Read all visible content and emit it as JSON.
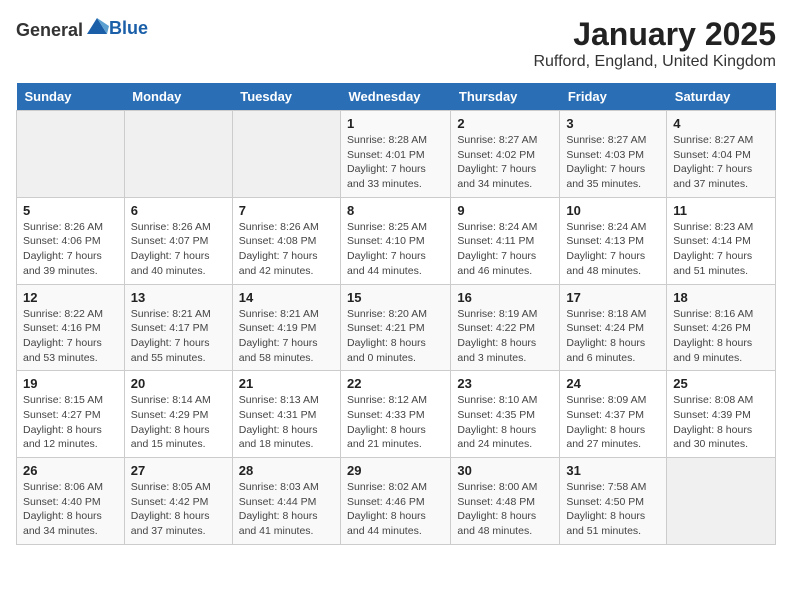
{
  "header": {
    "logo_general": "General",
    "logo_blue": "Blue",
    "title": "January 2025",
    "location": "Rufford, England, United Kingdom"
  },
  "days_of_week": [
    "Sunday",
    "Monday",
    "Tuesday",
    "Wednesday",
    "Thursday",
    "Friday",
    "Saturday"
  ],
  "weeks": [
    [
      {
        "day": "",
        "sunrise": "",
        "sunset": "",
        "daylight": ""
      },
      {
        "day": "",
        "sunrise": "",
        "sunset": "",
        "daylight": ""
      },
      {
        "day": "",
        "sunrise": "",
        "sunset": "",
        "daylight": ""
      },
      {
        "day": "1",
        "sunrise": "Sunrise: 8:28 AM",
        "sunset": "Sunset: 4:01 PM",
        "daylight": "Daylight: 7 hours and 33 minutes."
      },
      {
        "day": "2",
        "sunrise": "Sunrise: 8:27 AM",
        "sunset": "Sunset: 4:02 PM",
        "daylight": "Daylight: 7 hours and 34 minutes."
      },
      {
        "day": "3",
        "sunrise": "Sunrise: 8:27 AM",
        "sunset": "Sunset: 4:03 PM",
        "daylight": "Daylight: 7 hours and 35 minutes."
      },
      {
        "day": "4",
        "sunrise": "Sunrise: 8:27 AM",
        "sunset": "Sunset: 4:04 PM",
        "daylight": "Daylight: 7 hours and 37 minutes."
      }
    ],
    [
      {
        "day": "5",
        "sunrise": "Sunrise: 8:26 AM",
        "sunset": "Sunset: 4:06 PM",
        "daylight": "Daylight: 7 hours and 39 minutes."
      },
      {
        "day": "6",
        "sunrise": "Sunrise: 8:26 AM",
        "sunset": "Sunset: 4:07 PM",
        "daylight": "Daylight: 7 hours and 40 minutes."
      },
      {
        "day": "7",
        "sunrise": "Sunrise: 8:26 AM",
        "sunset": "Sunset: 4:08 PM",
        "daylight": "Daylight: 7 hours and 42 minutes."
      },
      {
        "day": "8",
        "sunrise": "Sunrise: 8:25 AM",
        "sunset": "Sunset: 4:10 PM",
        "daylight": "Daylight: 7 hours and 44 minutes."
      },
      {
        "day": "9",
        "sunrise": "Sunrise: 8:24 AM",
        "sunset": "Sunset: 4:11 PM",
        "daylight": "Daylight: 7 hours and 46 minutes."
      },
      {
        "day": "10",
        "sunrise": "Sunrise: 8:24 AM",
        "sunset": "Sunset: 4:13 PM",
        "daylight": "Daylight: 7 hours and 48 minutes."
      },
      {
        "day": "11",
        "sunrise": "Sunrise: 8:23 AM",
        "sunset": "Sunset: 4:14 PM",
        "daylight": "Daylight: 7 hours and 51 minutes."
      }
    ],
    [
      {
        "day": "12",
        "sunrise": "Sunrise: 8:22 AM",
        "sunset": "Sunset: 4:16 PM",
        "daylight": "Daylight: 7 hours and 53 minutes."
      },
      {
        "day": "13",
        "sunrise": "Sunrise: 8:21 AM",
        "sunset": "Sunset: 4:17 PM",
        "daylight": "Daylight: 7 hours and 55 minutes."
      },
      {
        "day": "14",
        "sunrise": "Sunrise: 8:21 AM",
        "sunset": "Sunset: 4:19 PM",
        "daylight": "Daylight: 7 hours and 58 minutes."
      },
      {
        "day": "15",
        "sunrise": "Sunrise: 8:20 AM",
        "sunset": "Sunset: 4:21 PM",
        "daylight": "Daylight: 8 hours and 0 minutes."
      },
      {
        "day": "16",
        "sunrise": "Sunrise: 8:19 AM",
        "sunset": "Sunset: 4:22 PM",
        "daylight": "Daylight: 8 hours and 3 minutes."
      },
      {
        "day": "17",
        "sunrise": "Sunrise: 8:18 AM",
        "sunset": "Sunset: 4:24 PM",
        "daylight": "Daylight: 8 hours and 6 minutes."
      },
      {
        "day": "18",
        "sunrise": "Sunrise: 8:16 AM",
        "sunset": "Sunset: 4:26 PM",
        "daylight": "Daylight: 8 hours and 9 minutes."
      }
    ],
    [
      {
        "day": "19",
        "sunrise": "Sunrise: 8:15 AM",
        "sunset": "Sunset: 4:27 PM",
        "daylight": "Daylight: 8 hours and 12 minutes."
      },
      {
        "day": "20",
        "sunrise": "Sunrise: 8:14 AM",
        "sunset": "Sunset: 4:29 PM",
        "daylight": "Daylight: 8 hours and 15 minutes."
      },
      {
        "day": "21",
        "sunrise": "Sunrise: 8:13 AM",
        "sunset": "Sunset: 4:31 PM",
        "daylight": "Daylight: 8 hours and 18 minutes."
      },
      {
        "day": "22",
        "sunrise": "Sunrise: 8:12 AM",
        "sunset": "Sunset: 4:33 PM",
        "daylight": "Daylight: 8 hours and 21 minutes."
      },
      {
        "day": "23",
        "sunrise": "Sunrise: 8:10 AM",
        "sunset": "Sunset: 4:35 PM",
        "daylight": "Daylight: 8 hours and 24 minutes."
      },
      {
        "day": "24",
        "sunrise": "Sunrise: 8:09 AM",
        "sunset": "Sunset: 4:37 PM",
        "daylight": "Daylight: 8 hours and 27 minutes."
      },
      {
        "day": "25",
        "sunrise": "Sunrise: 8:08 AM",
        "sunset": "Sunset: 4:39 PM",
        "daylight": "Daylight: 8 hours and 30 minutes."
      }
    ],
    [
      {
        "day": "26",
        "sunrise": "Sunrise: 8:06 AM",
        "sunset": "Sunset: 4:40 PM",
        "daylight": "Daylight: 8 hours and 34 minutes."
      },
      {
        "day": "27",
        "sunrise": "Sunrise: 8:05 AM",
        "sunset": "Sunset: 4:42 PM",
        "daylight": "Daylight: 8 hours and 37 minutes."
      },
      {
        "day": "28",
        "sunrise": "Sunrise: 8:03 AM",
        "sunset": "Sunset: 4:44 PM",
        "daylight": "Daylight: 8 hours and 41 minutes."
      },
      {
        "day": "29",
        "sunrise": "Sunrise: 8:02 AM",
        "sunset": "Sunset: 4:46 PM",
        "daylight": "Daylight: 8 hours and 44 minutes."
      },
      {
        "day": "30",
        "sunrise": "Sunrise: 8:00 AM",
        "sunset": "Sunset: 4:48 PM",
        "daylight": "Daylight: 8 hours and 48 minutes."
      },
      {
        "day": "31",
        "sunrise": "Sunrise: 7:58 AM",
        "sunset": "Sunset: 4:50 PM",
        "daylight": "Daylight: 8 hours and 51 minutes."
      },
      {
        "day": "",
        "sunrise": "",
        "sunset": "",
        "daylight": ""
      }
    ]
  ]
}
